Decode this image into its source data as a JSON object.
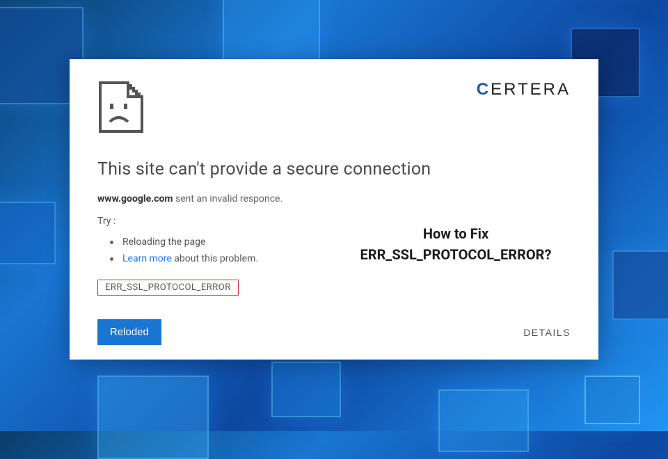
{
  "brand": {
    "first_letter": "C",
    "rest": "ERTERA"
  },
  "error": {
    "title": "This site can't provide a secure connection",
    "domain": "www.google.com",
    "desc_suffix": " sent an invalid responce.",
    "try_label": "Try :",
    "suggestions": {
      "reload": "Reloading the page",
      "learn_link": "Learn more",
      "learn_suffix": " about this problem."
    },
    "code": "ERR_SSL_PROTOCOL_ERROR"
  },
  "buttons": {
    "reload": "Reloded",
    "details": "DETAILS"
  },
  "callout": {
    "line1": "How to Fix",
    "line2": "ERR_SSL_PROTOCOL_ERROR?"
  }
}
